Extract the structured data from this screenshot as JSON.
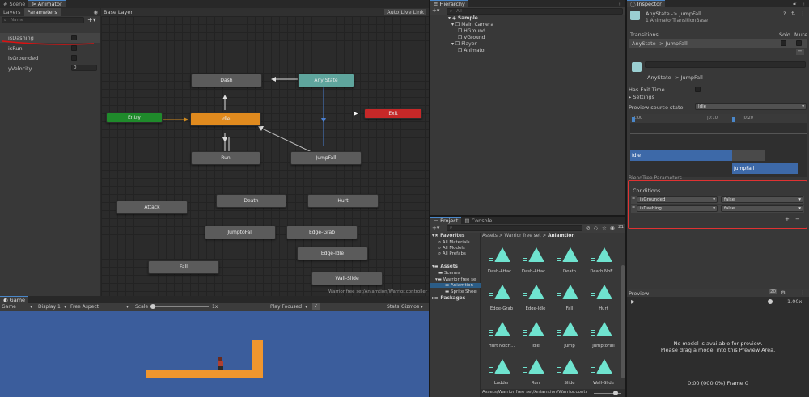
{
  "animator": {
    "tabs": {
      "scene": "Scene",
      "animator": "Animator"
    },
    "subtabs": {
      "layers": "Layers",
      "parameters": "Parameters"
    },
    "search_placeholder": "Name",
    "layer_title": "Base Layer",
    "auto_live_link": "Auto Live Link",
    "path": "Warrior free set/Aniamtion/Warrior.controller",
    "params": [
      {
        "name": "isDashing",
        "value": ""
      },
      {
        "name": "isRun",
        "value": ""
      },
      {
        "name": "isGrounded",
        "value": ""
      },
      {
        "name": "yVelocity",
        "value": "0"
      }
    ],
    "states": {
      "entry": "Entry",
      "any_state": "Any State",
      "exit": "Exit",
      "dash": "Dash",
      "idle": "Idle",
      "run": "Run",
      "jumpfall": "JumpFall",
      "death": "Death",
      "hurt": "Hurt",
      "attack": "Attack",
      "jumptofall": "JumptoFall",
      "edge_grab": "Edge-Grab",
      "edge_idle": "Edge-Idle",
      "fall": "Fall",
      "wall_slide": "Wall-Slide"
    },
    "colors": {
      "entry": "#1f8a2b",
      "any_state": "#5fa59d",
      "exit": "#c62828",
      "idle": "#e08a1e",
      "default": "#5b5b5b"
    }
  },
  "game": {
    "tab": "Game",
    "toolbar": {
      "display_mode": "Game",
      "display": "Display 1",
      "aspect": "Free Aspect",
      "scale_label": "Scale",
      "scale_value": "1x",
      "play_focused": "Play Focused",
      "stats": "Stats",
      "gizmos": "Gizmos"
    },
    "colors": {
      "sky": "#3b5d9c",
      "platform": "#f0962e"
    }
  },
  "hierarchy": {
    "tab": "Hierarchy",
    "search": "All",
    "items": [
      {
        "label": "Sample",
        "depth": 0
      },
      {
        "label": "Main Camera",
        "depth": 1
      },
      {
        "label": "HGround",
        "depth": 2
      },
      {
        "label": "VGround",
        "depth": 2
      },
      {
        "label": "Player",
        "depth": 1
      },
      {
        "label": "Animator",
        "depth": 2
      }
    ]
  },
  "project": {
    "tabs": {
      "project": "Project",
      "console": "Console"
    },
    "count": "21",
    "tree": [
      {
        "label": "Favorites",
        "depth": 0,
        "bold": true
      },
      {
        "label": "All Materials",
        "depth": 1
      },
      {
        "label": "All Models",
        "depth": 1
      },
      {
        "label": "All Prefabs",
        "depth": 1
      },
      {
        "label": "Assets",
        "depth": 0,
        "bold": true
      },
      {
        "label": "Scenes",
        "depth": 1
      },
      {
        "label": "Warrior free se",
        "depth": 1
      },
      {
        "label": "Aniamtion",
        "depth": 2
      },
      {
        "label": "Sprite Shee",
        "depth": 2
      },
      {
        "label": "Packages",
        "depth": 0,
        "bold": true
      }
    ],
    "breadcrumb": [
      "Assets",
      "Warrior free set",
      "Aniamtion"
    ],
    "assets": [
      "Dash-Attac...",
      "Dash-Attac...",
      "Death",
      "Death NoE...",
      "Edge-Grab",
      "Edge-Idle",
      "Fall",
      "Hurt",
      "Hurt NoEff...",
      "Idle",
      "Jump",
      "JumptoFall",
      "Ladder",
      "Run",
      "Slide",
      "Wall-Slide"
    ],
    "footer_path": "Assets/Warrior free set/Aniamtion/Warrior.contr"
  },
  "inspector": {
    "tab": "Inspector",
    "title": "AnyState -> JumpFall",
    "subtitle": "1 AnimatorTransitionBase",
    "transitions_label": "Transitions",
    "solo": "Solo",
    "mute": "Mute",
    "transition_item": "AnyState -> JumpFall",
    "name_label": "AnyState -> JumpFall",
    "has_exit_time": "Has Exit Time",
    "settings": "Settings",
    "preview_source_label": "Preview source state",
    "preview_source_value": "Idle",
    "timeline_ticks": [
      "1:00",
      "|0:10",
      "|0:20"
    ],
    "bar_idle": "Idle",
    "bar_jumpfall": "JumpFall",
    "blend_tree_params": "BlendTree Parameters",
    "conditions_label": "Conditions",
    "conditions": [
      {
        "param": "isGrounded",
        "value": "false"
      },
      {
        "param": "isDashing",
        "value": "false"
      }
    ],
    "preview": {
      "label": "Preview",
      "speed": "1.00x",
      "fps": "20",
      "no_model_line1": "No model is available for preview.",
      "no_model_line2": "Please drag a model into this Preview Area.",
      "frame": "0:00 (000.0%) Frame 0"
    }
  }
}
